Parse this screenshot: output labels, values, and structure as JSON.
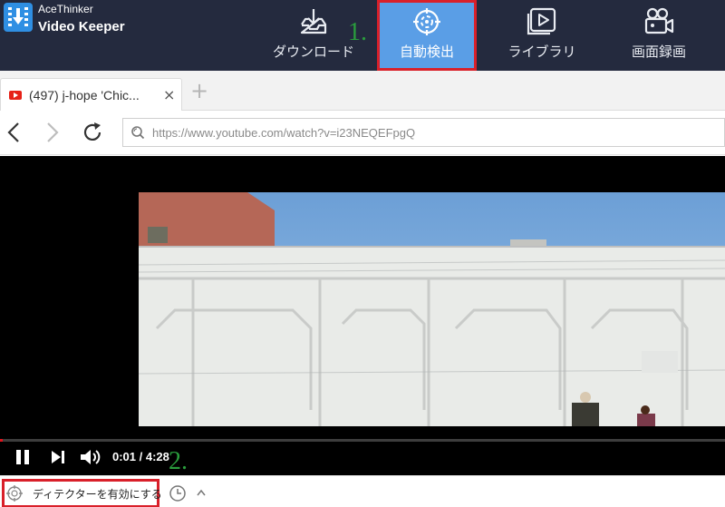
{
  "app": {
    "brand_sub": "AceThinker",
    "brand_main": "Video Keeper",
    "tabs": [
      {
        "label": "ダウンロード",
        "icon": "download-tray-icon"
      },
      {
        "label": "自動検出",
        "icon": "target-crosshair-icon",
        "active": true
      },
      {
        "label": "ライブラリ",
        "icon": "video-library-icon"
      },
      {
        "label": "画面録画",
        "icon": "video-camera-icon"
      }
    ],
    "accent_color": "#5a9ee6",
    "highlight_color": "#d9202a",
    "topbar_color": "#242a3e"
  },
  "annotations": {
    "step1": "1.",
    "step2": "2."
  },
  "browser": {
    "tab_title": "(497) j-hope 'Chic...",
    "tab_close": "×",
    "new_tab": "+",
    "url": "https://www.youtube.com/watch?v=i23NEQEFpgQ"
  },
  "player": {
    "time": "0:01 / 4:28",
    "progress_fraction": 0.004
  },
  "statusbar": {
    "detector_label": "ディテクターを有効にする"
  }
}
